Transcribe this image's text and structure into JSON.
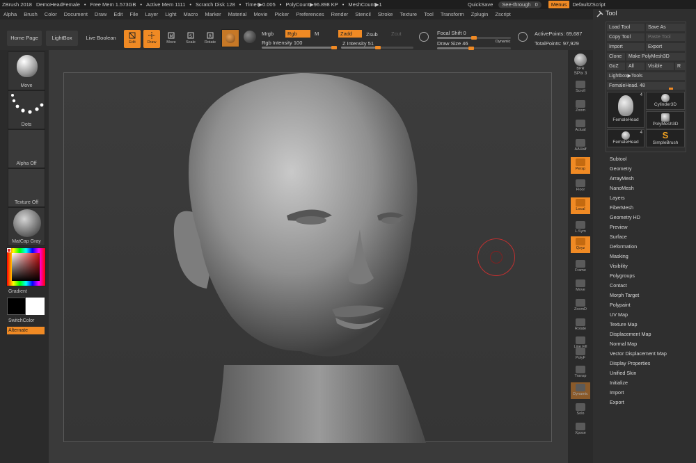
{
  "titlebar": {
    "app": "ZBrush 2018",
    "document": "DemoHeadFemale",
    "sep": "•",
    "free_mem": "Free Mem 1.573GB",
    "active_mem": "Active Mem 1111",
    "scratch": "Scratch Disk 128",
    "timer": "Timer▶0.005",
    "polycount": "PolyCount▶96.898 KP",
    "meshcount": "MeshCount▶1",
    "quicksave": "QuickSave",
    "seethrough_label": "See-through",
    "seethrough_value": "0",
    "menus": "Menus",
    "script": "DefaultZScript"
  },
  "menubar": [
    "Alpha",
    "Brush",
    "Color",
    "Document",
    "Draw",
    "Edit",
    "File",
    "Layer",
    "Light",
    "Macro",
    "Marker",
    "Material",
    "Movie",
    "Picker",
    "Preferences",
    "Render",
    "Stencil",
    "Stroke",
    "Texture",
    "Tool",
    "Transform",
    "Zplugin",
    "Zscript"
  ],
  "shelf": {
    "home_page": "Home Page",
    "lightbox": "LightBox",
    "live_boolean": "Live Boolean",
    "edit": "Edit",
    "draw": "Draw",
    "move": "Move",
    "scale": "Scale",
    "rotate": "Rotate",
    "mrgb": "Mrgb",
    "rgb": "Rgb",
    "m": "M",
    "zadd": "Zadd",
    "zsub": "Zsub",
    "zcut": "Zcut",
    "rgb_intensity": "Rgb Intensity 100",
    "z_intensity": "Z Intensity 51",
    "focal_shift": "Focal Shift 0",
    "draw_size": "Draw Size 46",
    "dynamic": "Dynamic",
    "active_points": "ActivePoints: 69,687",
    "total_points": "TotalPoints: 97,929",
    "rgb_intensity_value": 100,
    "z_intensity_value": 51,
    "focal_shift_value": 0,
    "draw_size_value": 46
  },
  "leftpanel": {
    "brush": "Move",
    "stroke": "Dots",
    "alpha": "Alpha Off",
    "texture": "Texture Off",
    "material": "MatCap Gray",
    "gradient": "Gradient",
    "switch_color": "SwitchColor",
    "alternate": "Alternate"
  },
  "rightstrip": {
    "bpr": "BPR",
    "spix": "SPix 3",
    "buttons": [
      "Scroll",
      "Zoom",
      "Actual",
      "AAHalf",
      "Persp",
      "Floor",
      "Local",
      "L.Sym",
      "Qxyz",
      "Frame",
      "Move",
      "ZoomD",
      "Rotate",
      "Line Fill",
      "PolyF",
      "Transp",
      "Dynamic",
      "Solo",
      "Xpose"
    ]
  },
  "toolpanel": {
    "title": "Tool",
    "load_tool": "Load Tool",
    "save_as": "Save As",
    "copy_tool": "Copy Tool",
    "paste_tool": "Paste Tool",
    "import": "Import",
    "export": "Export",
    "clone": "Clone",
    "make_polymesh": "Make PolyMesh3D",
    "goz": "GoZ",
    "all": "All",
    "visible": "Visible",
    "r": "R",
    "lightbox_tools": "Lightbox▶Tools",
    "current_tool": "FemaleHead. 48",
    "current_tool_value": 48,
    "thumbs": [
      {
        "name": "FemaleHead",
        "count": "4"
      },
      {
        "name": "Cylinder3D",
        "count": ""
      },
      {
        "name": "PolyMesh3D",
        "count": ""
      },
      {
        "name": "FemaleHead",
        "count": "4"
      },
      {
        "name": "SimpleBrush",
        "count": ""
      }
    ],
    "subpalettes": [
      "Subtool",
      "Geometry",
      "ArrayMesh",
      "NanoMesh",
      "Layers",
      "FiberMesh",
      "Geometry HD",
      "Preview",
      "Surface",
      "Deformation",
      "Masking",
      "Visibility",
      "Polygroups",
      "Contact",
      "Morph Target",
      "Polypaint",
      "UV Map",
      "Texture Map",
      "Displacement Map",
      "Normal Map",
      "Vector Displacement Map",
      "Display Properties",
      "Unified Skin",
      "Initialize",
      "Import",
      "Export"
    ]
  },
  "colors": {
    "accent": "#f08a24",
    "background": "#2b2b2b",
    "canvas": "#3a3a3a"
  }
}
